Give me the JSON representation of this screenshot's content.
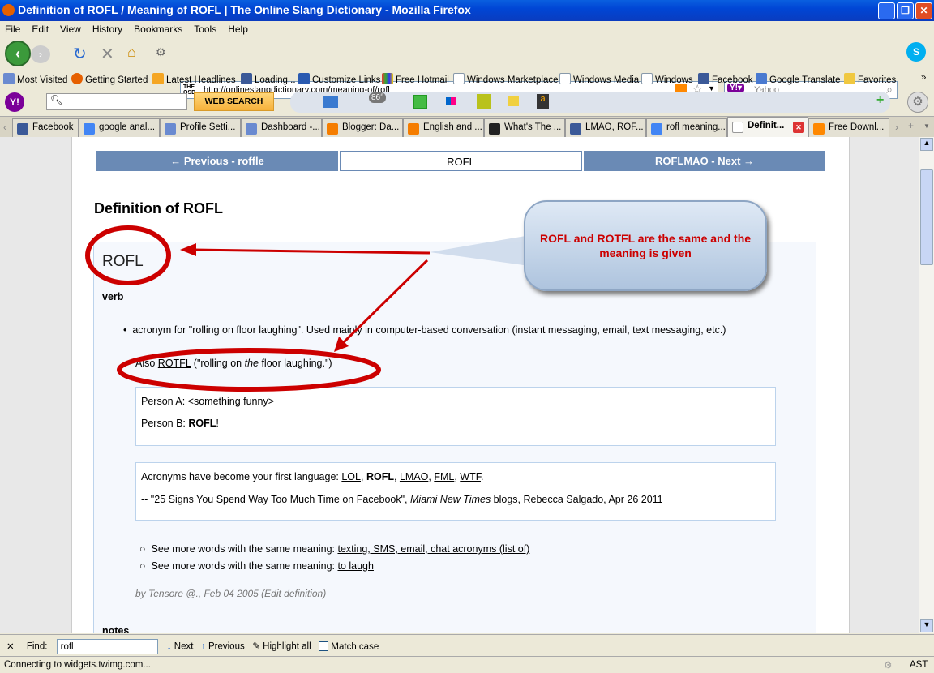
{
  "window": {
    "title": "Definition of ROFL / Meaning of ROFL | The Online Slang Dictionary - Mozilla Firefox"
  },
  "menu": [
    "File",
    "Edit",
    "View",
    "History",
    "Bookmarks",
    "Tools",
    "Help"
  ],
  "nav": {
    "url": "http://onlineslangdictionary.com/meaning-of/rofl",
    "search_placeholder": "Yahoo",
    "site_badge": "THE OSD"
  },
  "bookmarks": [
    "Most Visited",
    "Getting Started",
    "Latest Headlines",
    "Loading...",
    "Customize Links",
    "Free Hotmail",
    "Windows Marketplace",
    "Windows Media",
    "Windows",
    "Facebook",
    "Google Translate",
    "Favorites"
  ],
  "yahoo_toolbar": {
    "search_button": "WEB SEARCH",
    "weather": "86°"
  },
  "tabs": [
    {
      "label": "Facebook"
    },
    {
      "label": "google anal..."
    },
    {
      "label": "Profile Setti..."
    },
    {
      "label": "Dashboard -..."
    },
    {
      "label": "Blogger: Da..."
    },
    {
      "label": "English and ..."
    },
    {
      "label": "What's The ..."
    },
    {
      "label": "LMAO, ROF..."
    },
    {
      "label": "rofl meaning..."
    },
    {
      "label": "Definit...",
      "active": true
    },
    {
      "label": "Free Downl..."
    }
  ],
  "page": {
    "prev": "← Previous - roffle",
    "current": "ROFL",
    "next": "ROFLMAO - Next →",
    "heading": "Definition of ROFL",
    "term": "ROFL",
    "pos": "verb",
    "definition": "acronym for \"rolling on floor laughing\". Used mainly in computer-based conversation (instant messaging, email, text messaging, etc.)",
    "also_prefix": "Also ",
    "also_link": "ROTFL",
    "also_a": " (\"rolling on ",
    "also_em": "the",
    "also_b": " floor laughing.\")",
    "ex1_a": "Person A: <something funny>",
    "ex1_b_prefix": "Person B: ",
    "ex1_b_bold": "ROFL",
    "ex1_b_suffix": "!",
    "ex2_prefix": "Acronyms have become your first language: ",
    "ex2_links": [
      "LOL",
      "ROFL",
      "LMAO",
      "FML",
      "WTF"
    ],
    "ex2_cite_prefix": "-- \"",
    "ex2_cite_link": "25 Signs You Spend Way Too Much Time on Facebook",
    "ex2_cite_mid": "\", ",
    "ex2_cite_em": "Miami New Times",
    "ex2_cite_suffix": " blogs, Rebecca Salgado, Apr 26 2011",
    "see_more_label": "See more words with the same meaning: ",
    "see_more": [
      "texting, SMS, email, chat acronyms (list of)",
      "to laugh"
    ],
    "byline": "by Tensore @., Feb 04 2005  (",
    "edit_link": "Edit definition",
    "byline_end": ")",
    "notes": "notes"
  },
  "annotation": {
    "callout": "ROFL and ROTFL  are the same and the meaning is given",
    "color": "#cc0000"
  },
  "findbar": {
    "label": "Find:",
    "value": "rofl",
    "next": "Next",
    "previous": "Previous",
    "highlight": "Highlight all",
    "match_case": "Match case"
  },
  "status": {
    "text": "Connecting to widgets.twimg.com...",
    "right": "AST"
  }
}
